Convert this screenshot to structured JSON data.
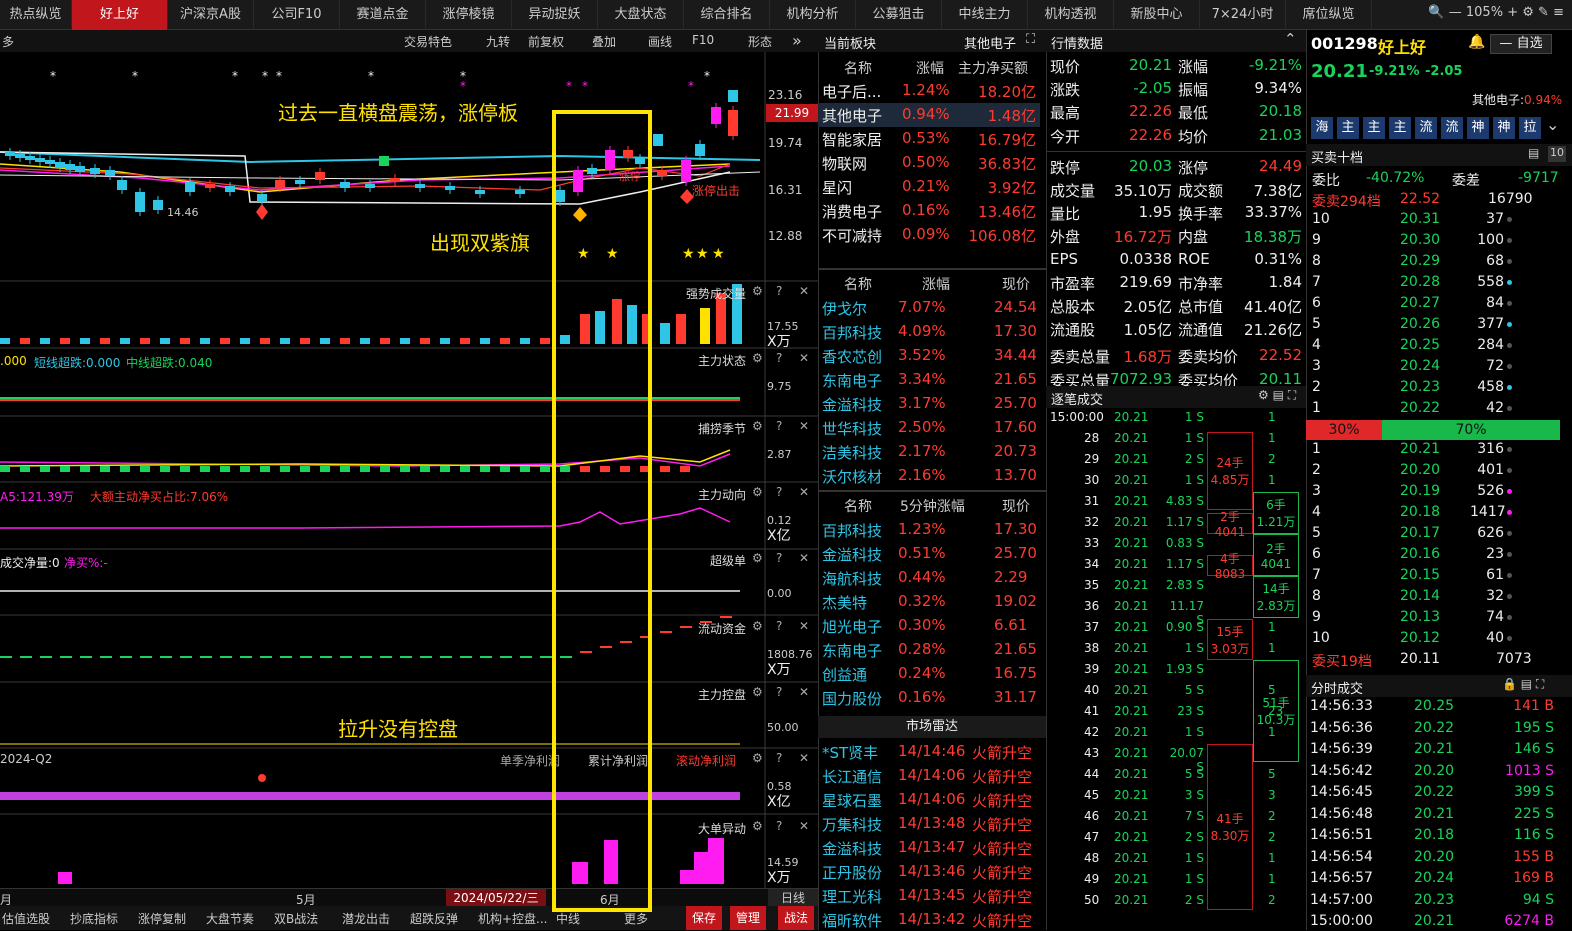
{
  "tabs": [
    "热点纵览",
    "好上好",
    "沪深京A股",
    "公司F10",
    "赛道点金",
    "涨停棱镜",
    "异动捉妖",
    "大盘状态",
    "综合排名",
    "机构分析",
    "公募狙击",
    "中线主力",
    "机构透视",
    "新股中心",
    "7×24小时",
    "席位纵览"
  ],
  "zoom": "105%",
  "chart_toolbar": {
    "more": "多",
    "items": [
      "交易特色",
      "九转",
      "前复权",
      "叠加",
      "画线",
      "F10",
      "形态"
    ]
  },
  "main_chart": {
    "price_ticks": [
      "23.16",
      "21.99",
      "19.74",
      "16.31",
      "12.88"
    ],
    "low_label": "14.46",
    "annotation1": "过去一直横盘震荡，涨停板",
    "annotation2": "出现双紫旗",
    "annotation3": "拉升没有控盘",
    "limit_up_out": "涨停出击",
    "limit_up_label": "涨停"
  },
  "indicators": [
    {
      "name": "强势成交量",
      "tick": "17.55",
      "unit": "X万"
    },
    {
      "name": "主力状态",
      "tick": "9.75",
      "legend_a": ".000",
      "legend_b": "短线超跌:0.000",
      "legend_c": "中线超跌:0.040"
    },
    {
      "name": "捕捞季节",
      "tick": "2.87"
    },
    {
      "name": "主力动向",
      "tick": "0.12",
      "unit": "X亿",
      "legend_a": "A5:121.39万",
      "legend_b": "大额主动净买占比:7.06%"
    },
    {
      "name": "超级单",
      "tick": "0.00",
      "legend_a": "成交净量:0",
      "legend_b": "净买%:-"
    },
    {
      "name": "流动资金",
      "tick": "1808.76",
      "unit": "X万"
    },
    {
      "name": "主力控盘",
      "tick": "50.00"
    },
    {
      "name": "",
      "tick": "0.58",
      "unit": "X亿",
      "legend_a": "2024-Q2",
      "legend_b": "单季净利润",
      "legend_c": "累计净利润",
      "legend_d": "滚动净利润"
    },
    {
      "name": "大单异动",
      "tick": "14.59",
      "unit": "X万"
    }
  ],
  "date_axis": {
    "left": "月",
    "may": "5月",
    "cursor": "2024/05/22/三",
    "jun": "6月",
    "mode": "日线"
  },
  "bottom_tabs": [
    "估值选股",
    "抄底指标",
    "涨停复制",
    "大盘节奏",
    "双B战法",
    "潜龙出击",
    "超跌反弹",
    "机构+控盘...",
    "中线",
    "更多"
  ],
  "bottom_buttons": [
    "保存",
    "管理",
    "战法"
  ],
  "sector": {
    "title": "当前板块",
    "current": "其他电子",
    "headers": [
      "名称",
      "涨幅",
      "主力净买额"
    ],
    "rows": [
      [
        "电子后...",
        "1.24%",
        "18.20亿"
      ],
      [
        "其他电子",
        "0.94%",
        "1.48亿"
      ],
      [
        "智能家居",
        "0.53%",
        "16.79亿"
      ],
      [
        "物联网",
        "0.50%",
        "36.83亿"
      ],
      [
        "星闪",
        "0.21%",
        "3.92亿"
      ],
      [
        "消费电子",
        "0.16%",
        "13.46亿"
      ],
      [
        "不可减持",
        "0.09%",
        "106.08亿"
      ]
    ]
  },
  "stocks1": {
    "headers": [
      "名称",
      "涨幅",
      "现价"
    ],
    "rows": [
      [
        "伊戈尔",
        "7.07%",
        "24.54"
      ],
      [
        "百邦科技",
        "4.09%",
        "17.30"
      ],
      [
        "香农芯创",
        "3.52%",
        "34.44"
      ],
      [
        "东南电子",
        "3.34%",
        "21.65"
      ],
      [
        "金溢科技",
        "3.17%",
        "25.70"
      ],
      [
        "世华科技",
        "2.50%",
        "17.60"
      ],
      [
        "洁美科技",
        "2.17%",
        "20.73"
      ],
      [
        "沃尔核材",
        "2.16%",
        "13.70"
      ]
    ]
  },
  "stocks2": {
    "headers": [
      "名称",
      "5分钟涨幅",
      "现价"
    ],
    "rows": [
      [
        "百邦科技",
        "1.23%",
        "17.30"
      ],
      [
        "金溢科技",
        "0.51%",
        "25.70"
      ],
      [
        "海航科技",
        "0.44%",
        "2.29"
      ],
      [
        "杰美特",
        "0.32%",
        "19.02"
      ],
      [
        "旭光电子",
        "0.30%",
        "6.61"
      ],
      [
        "东南电子",
        "0.28%",
        "21.65"
      ],
      [
        "创益通",
        "0.24%",
        "16.75"
      ],
      [
        "国力股份",
        "0.16%",
        "31.17"
      ]
    ]
  },
  "radar": {
    "title": "市场雷达",
    "rows": [
      [
        "*ST贤丰",
        "14/14:46",
        "火箭升空"
      ],
      [
        "长江通信",
        "14/14:06",
        "火箭升空"
      ],
      [
        "星球石墨",
        "14/14:06",
        "火箭升空"
      ],
      [
        "万集科技",
        "14/13:48",
        "火箭升空"
      ],
      [
        "金溢科技",
        "14/13:47",
        "火箭升空"
      ],
      [
        "正丹股份",
        "14/13:46",
        "火箭升空"
      ],
      [
        "理工光科",
        "14/13:45",
        "火箭升空"
      ],
      [
        "福昕软件",
        "14/13:42",
        "火箭升空"
      ]
    ]
  },
  "quote": {
    "title": "行情数据",
    "rows": [
      [
        "现价",
        "20.21",
        "涨幅",
        "-9.21%"
      ],
      [
        "涨跌",
        "-2.05",
        "振幅",
        "9.34%"
      ],
      [
        "最高",
        "22.26",
        "最低",
        "20.18"
      ],
      [
        "今开",
        "22.26",
        "均价",
        "21.03"
      ],
      [
        "跌停",
        "20.03",
        "涨停",
        "24.49"
      ],
      [
        "成交量",
        "35.10万",
        "成交额",
        "7.38亿"
      ],
      [
        "量比",
        "1.95",
        "换手率",
        "33.37%"
      ],
      [
        "外盘",
        "16.72万",
        "内盘",
        "18.38万"
      ],
      [
        "EPS",
        "0.0338",
        "ROE",
        "0.31%"
      ],
      [
        "市盈率",
        "219.69",
        "市净率",
        "1.84"
      ],
      [
        "总股本",
        "2.05亿",
        "总市值",
        "41.40亿"
      ],
      [
        "流通股",
        "1.05亿",
        "流通值",
        "21.26亿"
      ],
      [
        "委卖总量",
        "1.68万",
        "委卖均价",
        "22.52"
      ],
      [
        "委买总量",
        "7072.93",
        "委买均价",
        "20.11"
      ]
    ]
  },
  "ticks": {
    "title": "逐笔成交",
    "rows": [
      [
        "15:00:00",
        "20.21",
        "1 S"
      ],
      [
        "28",
        "20.21",
        "1 S"
      ],
      [
        "29",
        "20.21",
        "2 S"
      ],
      [
        "30",
        "20.21",
        "1 S"
      ],
      [
        "31",
        "20.21",
        "4.83 S"
      ],
      [
        "32",
        "20.21",
        "1.17 S"
      ],
      [
        "33",
        "20.21",
        "0.83 S"
      ],
      [
        "34",
        "20.21",
        "1.17 S"
      ],
      [
        "35",
        "20.21",
        "2.83 S"
      ],
      [
        "36",
        "20.21",
        "11.17 S"
      ],
      [
        "37",
        "20.21",
        "0.90 S"
      ],
      [
        "38",
        "20.21",
        "1 S"
      ],
      [
        "39",
        "20.21",
        "1.93 S"
      ],
      [
        "40",
        "20.21",
        "5 S"
      ],
      [
        "41",
        "20.21",
        "23 S"
      ],
      [
        "42",
        "20.21",
        "1 S"
      ],
      [
        "43",
        "20.21",
        "20.07 S"
      ],
      [
        "44",
        "20.21",
        "5 S"
      ],
      [
        "45",
        "20.21",
        "3 S"
      ],
      [
        "46",
        "20.21",
        "7 S"
      ],
      [
        "47",
        "20.21",
        "2 S"
      ],
      [
        "48",
        "20.21",
        "1 S"
      ],
      [
        "49",
        "20.21",
        "1 S"
      ],
      [
        "50",
        "20.21",
        "2 S"
      ]
    ],
    "bucket_left": [
      [
        "24手",
        "4.85万"
      ],
      [
        "2手",
        "4041"
      ],
      [
        "4手",
        "8083"
      ],
      [
        "15手",
        "3.03万"
      ],
      [
        "41手",
        "8.30万"
      ]
    ],
    "bucket_right": [
      [
        "6手",
        "1.21万"
      ],
      [
        "2手",
        "4041"
      ],
      [
        "14手",
        "2.83万"
      ],
      [
        "51手",
        "10.3万"
      ]
    ],
    "vols": [
      "1",
      "1",
      "2",
      "1",
      "",
      "",
      "",
      "",
      "",
      "",
      "1",
      "1",
      "",
      "5",
      "23",
      "1",
      "",
      "5",
      "3",
      "2",
      "2",
      "1",
      "1",
      "2"
    ]
  },
  "stock": {
    "code": "001298",
    "name": "好上好",
    "price": "20.21",
    "pct": "-9.21%",
    "chg": "-2.05",
    "sector": "其他电子:",
    "sector_pct": "0.94%",
    "watch": "自选"
  },
  "channels": [
    "海",
    "主",
    "主",
    "主",
    "流",
    "流",
    "神",
    "神",
    "拉"
  ],
  "order_book": {
    "title": "买卖十档",
    "ratio_label": "委比",
    "ratio": "-40.72%",
    "diff_label": "委差",
    "diff": "-9717",
    "sell_header": "委卖294档",
    "sell_price": "22.52",
    "sell_vol": "16790",
    "sells": [
      [
        "10",
        "20.31",
        "37"
      ],
      [
        "9",
        "20.30",
        "100"
      ],
      [
        "8",
        "20.29",
        "68"
      ],
      [
        "7",
        "20.28",
        "558"
      ],
      [
        "6",
        "20.27",
        "84"
      ],
      [
        "5",
        "20.26",
        "377"
      ],
      [
        "4",
        "20.25",
        "284"
      ],
      [
        "3",
        "20.24",
        "72"
      ],
      [
        "2",
        "20.23",
        "458"
      ],
      [
        "1",
        "20.22",
        "42"
      ]
    ],
    "bar_left": "30%",
    "bar_right": "70%",
    "buys": [
      [
        "1",
        "20.21",
        "316"
      ],
      [
        "2",
        "20.20",
        "401"
      ],
      [
        "3",
        "20.19",
        "526"
      ],
      [
        "4",
        "20.18",
        "1417"
      ],
      [
        "5",
        "20.17",
        "626"
      ],
      [
        "6",
        "20.16",
        "23"
      ],
      [
        "7",
        "20.15",
        "61"
      ],
      [
        "8",
        "20.14",
        "32"
      ],
      [
        "9",
        "20.13",
        "74"
      ],
      [
        "10",
        "20.12",
        "40"
      ]
    ],
    "buy_header": "委买19档",
    "buy_price": "20.11",
    "buy_vol": "7073"
  },
  "minute_trades": {
    "title": "分时成交",
    "rows": [
      [
        "14:56:33",
        "20.25",
        "141 B"
      ],
      [
        "14:56:36",
        "20.22",
        "195 S"
      ],
      [
        "14:56:39",
        "20.21",
        "146 S"
      ],
      [
        "14:56:42",
        "20.20",
        "1013 S"
      ],
      [
        "14:56:45",
        "20.22",
        "399 S"
      ],
      [
        "14:56:48",
        "20.21",
        "225 S"
      ],
      [
        "14:56:51",
        "20.18",
        "116 S"
      ],
      [
        "14:56:54",
        "20.20",
        "155 B"
      ],
      [
        "14:56:57",
        "20.24",
        "169 B"
      ],
      [
        "14:57:00",
        "20.23",
        "94 S"
      ],
      [
        "15:00:00",
        "20.21",
        "6274 B"
      ]
    ]
  }
}
